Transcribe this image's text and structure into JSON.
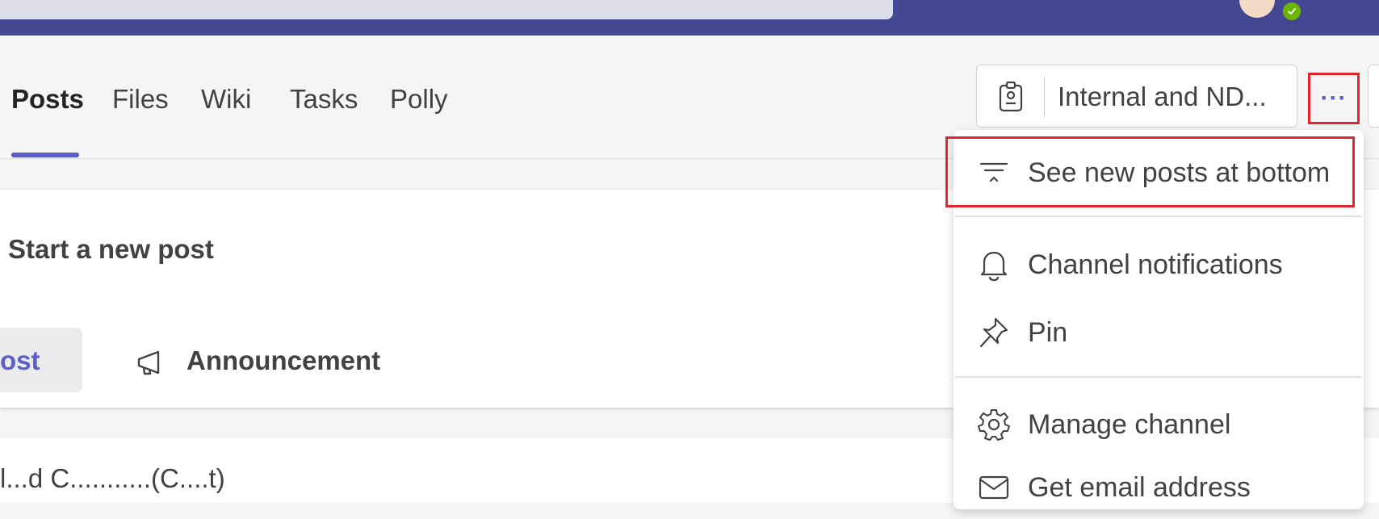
{
  "tabs": [
    {
      "label": "Posts",
      "active": true
    },
    {
      "label": "Files"
    },
    {
      "label": "Wiki"
    },
    {
      "label": "Tasks"
    },
    {
      "label": "Polly"
    }
  ],
  "sensitivity": {
    "label": "Internal and ND...",
    "icon": "badge-icon"
  },
  "more_options": {
    "label": "···"
  },
  "compose": {
    "title": "Start a new post",
    "post_button": "ost",
    "announcement_button": "Announcement"
  },
  "feed": {
    "partial_text": "l...d C...........(C....t)"
  },
  "menu": {
    "items": [
      {
        "label": "See new posts at bottom",
        "icon": "sort-bottom-icon"
      },
      {
        "label": "Channel notifications",
        "icon": "bell-icon"
      },
      {
        "label": "Pin",
        "icon": "pin-icon"
      },
      {
        "label": "Manage channel",
        "icon": "gear-icon"
      },
      {
        "label": "Get email address",
        "icon": "mail-icon"
      }
    ]
  },
  "colors": {
    "accent": "#5b5fc7",
    "topbar": "#444791",
    "highlight": "#e3262e",
    "presence": "#6bb700"
  }
}
